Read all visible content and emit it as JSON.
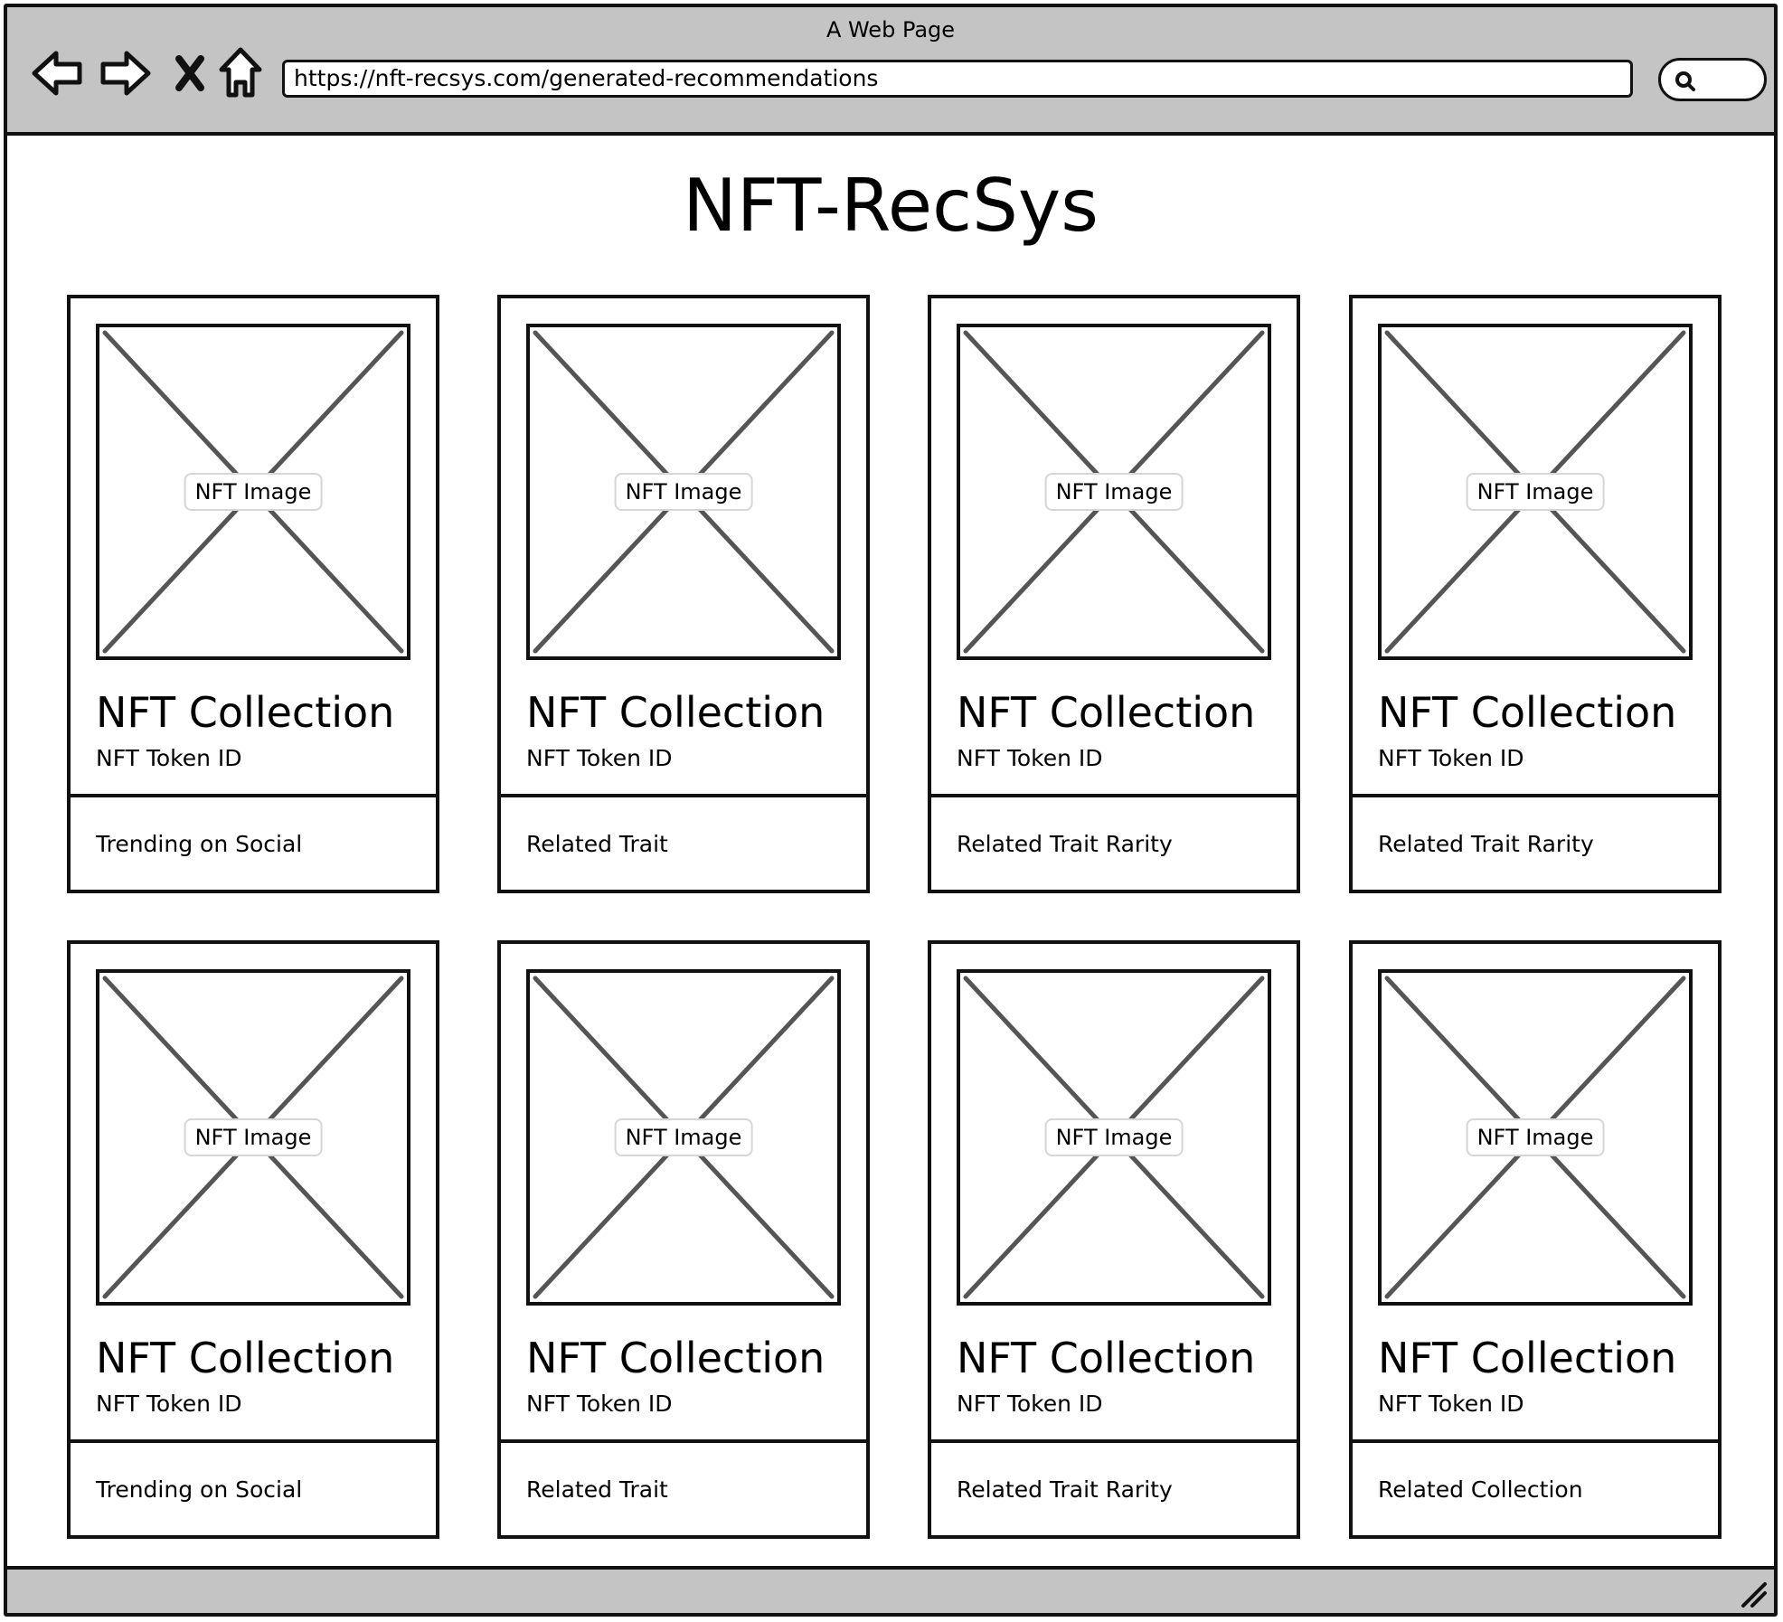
{
  "browser": {
    "title": "A Web Page",
    "url": "https://nft-recsys.com/generated-recommendations",
    "icons": [
      "back-arrow-icon",
      "forward-arrow-icon",
      "close-x-icon",
      "home-icon",
      "search-icon",
      "resize-grip-icon"
    ]
  },
  "page": {
    "title": "NFT-RecSys"
  },
  "cards": [
    {
      "image_label": "NFT Image",
      "collection": "NFT Collection",
      "token_id": "NFT Token ID",
      "reason": "Trending on Social"
    },
    {
      "image_label": "NFT Image",
      "collection": "NFT Collection",
      "token_id": "NFT Token ID",
      "reason": "Related Trait"
    },
    {
      "image_label": "NFT Image",
      "collection": "NFT Collection",
      "token_id": "NFT Token ID",
      "reason": "Related Trait Rarity"
    },
    {
      "image_label": "NFT Image",
      "collection": "NFT Collection",
      "token_id": "NFT Token ID",
      "reason": "Related Trait Rarity"
    },
    {
      "image_label": "NFT Image",
      "collection": "NFT Collection",
      "token_id": "NFT Token ID",
      "reason": "Trending on Social"
    },
    {
      "image_label": "NFT Image",
      "collection": "NFT Collection",
      "token_id": "NFT Token ID",
      "reason": "Related Trait"
    },
    {
      "image_label": "NFT Image",
      "collection": "NFT Collection",
      "token_id": "NFT Token ID",
      "reason": "Related Trait Rarity"
    },
    {
      "image_label": "NFT Image",
      "collection": "NFT Collection",
      "token_id": "NFT Token ID",
      "reason": "Related Collection"
    }
  ]
}
